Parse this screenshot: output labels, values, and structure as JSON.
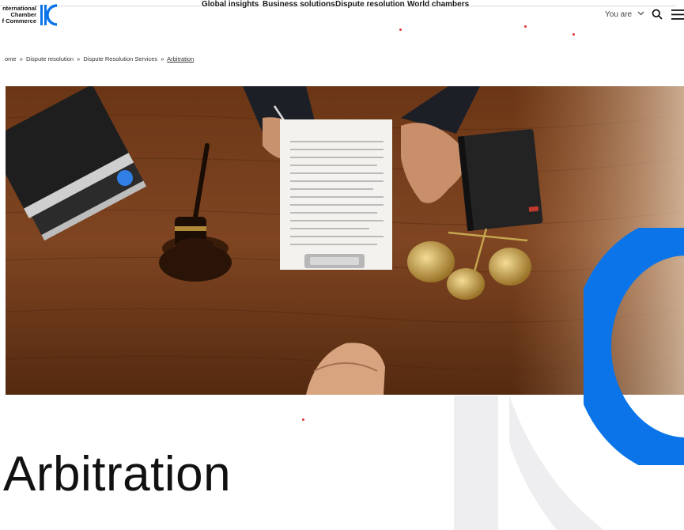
{
  "header": {
    "logo_lines": [
      "nternational",
      "Chamber",
      "f Commerce"
    ],
    "nav": [
      {
        "label": "Global insights"
      },
      {
        "label": "Business solutions"
      },
      {
        "label": "Dispute resolution"
      },
      {
        "label": "World chambers"
      }
    ],
    "you_are_label": "You are",
    "icons": {
      "search": "search-icon",
      "menu": "hamburger-menu-icon",
      "chevron": "chevron-down-icon"
    }
  },
  "breadcrumb": {
    "items": [
      "ome",
      "Dispute resolution",
      "Dispute Resolution Services"
    ],
    "separator": "»",
    "current": "Arbitration"
  },
  "hero": {
    "alt": "Lawyers at a wooden desk with gavel, documents, books and scales of justice"
  },
  "title": "Arbitration",
  "colors": {
    "brand_blue": "#0a74e8",
    "arc_gray": "#eeeef0",
    "text": "#1a1a1a"
  }
}
